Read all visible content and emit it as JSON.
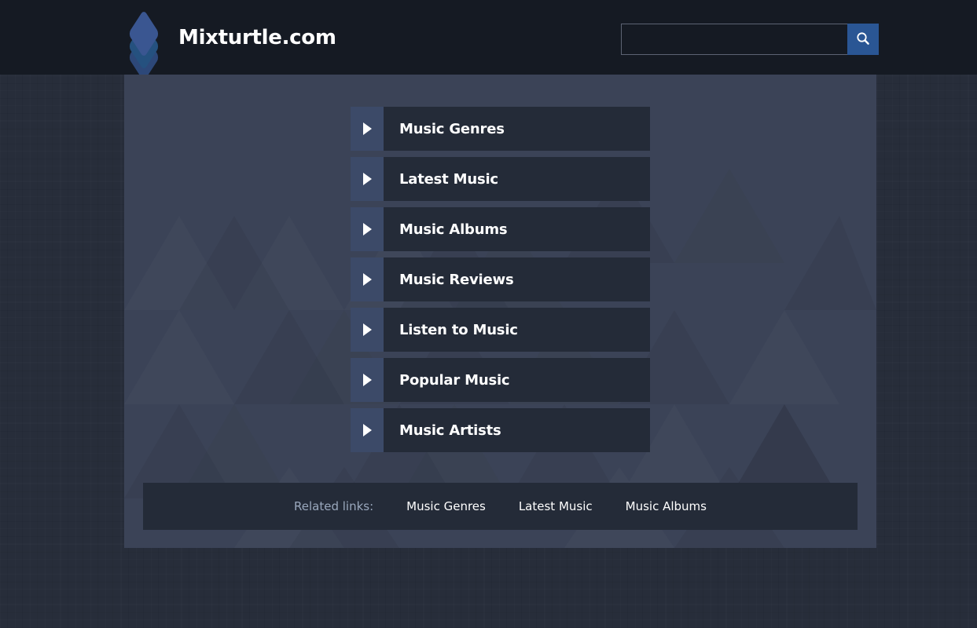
{
  "header": {
    "brand_name": "Mixturtle.com",
    "logo_icon": "stacked-layers-icon",
    "search": {
      "value": "",
      "placeholder": "",
      "button_icon": "search-icon"
    }
  },
  "main": {
    "menu_items": [
      {
        "label": "Music Genres",
        "arrow_icon": "triangle-right-icon"
      },
      {
        "label": "Latest Music",
        "arrow_icon": "triangle-right-icon"
      },
      {
        "label": "Music Albums",
        "arrow_icon": "triangle-right-icon"
      },
      {
        "label": "Music Reviews",
        "arrow_icon": "triangle-right-icon"
      },
      {
        "label": "Listen to Music",
        "arrow_icon": "triangle-right-icon"
      },
      {
        "label": "Popular Music",
        "arrow_icon": "triangle-right-icon"
      },
      {
        "label": "Music Artists",
        "arrow_icon": "triangle-right-icon"
      }
    ]
  },
  "footer": {
    "related_label": "Related links:",
    "links": [
      {
        "label": "Music Genres"
      },
      {
        "label": "Latest Music"
      },
      {
        "label": "Music Albums"
      }
    ]
  },
  "colors": {
    "page_background": "#272d3a",
    "header_background": "#151a23",
    "container_background": "#3b4357",
    "menu_arrow_block": "#3c4a68",
    "menu_label_block": "#242b38",
    "accent_blue": "#2a5694",
    "muted_text": "#9aa8bd",
    "text": "#ffffff"
  }
}
